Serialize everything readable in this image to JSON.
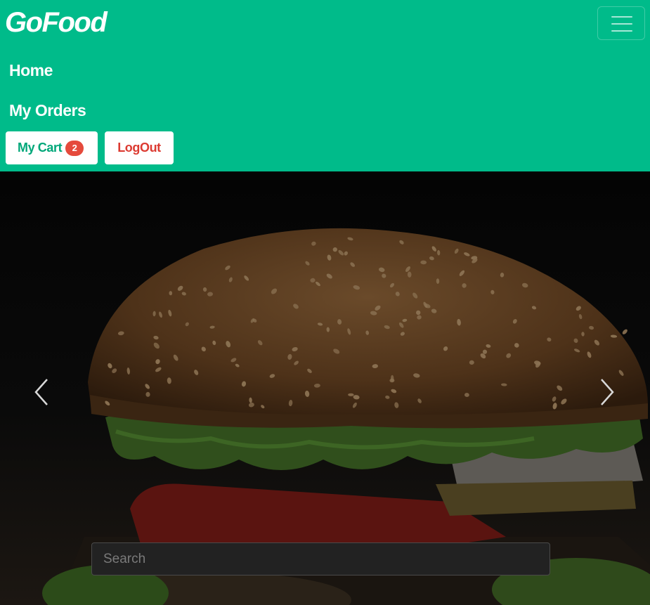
{
  "navbar": {
    "brand": "GoFood",
    "menu_icon": "hamburger-menu-icon",
    "links": {
      "home": "Home",
      "orders": "My Orders"
    },
    "cart": {
      "label": "My Cart",
      "count": "2"
    },
    "logout_label": "LogOut",
    "colors": {
      "background": "#00bb8a",
      "cart_text": "#00a779",
      "logout_text": "#dc3b32",
      "badge": "#e54a3c"
    }
  },
  "carousel": {
    "image": "burger-image",
    "prev_icon": "chevron-left-icon",
    "next_icon": "chevron-right-icon",
    "search": {
      "placeholder": "Search",
      "value": ""
    }
  }
}
